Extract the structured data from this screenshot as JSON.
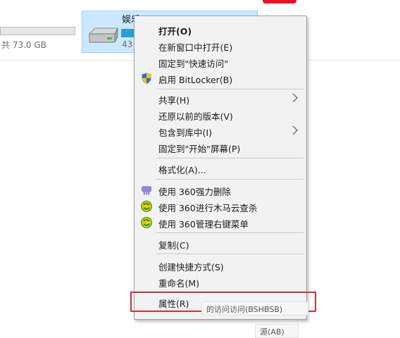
{
  "explorer": {
    "left_drive_caption": "共 73.0 GB",
    "selected_drive": {
      "name": "娱乐 (G:)",
      "size_text": "43",
      "usage_fraction": 0.1
    },
    "colors": {
      "selection": "#cce8ff",
      "usage_bar": "#26a0da",
      "accent": "#e81123"
    }
  },
  "context_menu": {
    "items": [
      {
        "id": "open",
        "label": "打开(O)",
        "bold": true
      },
      {
        "id": "open-new-window",
        "label": "在新窗口中打开(E)"
      },
      {
        "id": "pin-quick-access",
        "label": "固定到\"快速访问\""
      },
      {
        "id": "bitlocker",
        "label": "启用 BitLocker(B)",
        "icon": "shield-icon"
      },
      {
        "id": "share",
        "label": "共享(H)",
        "submenu": true
      },
      {
        "id": "restore-versions",
        "label": "还原以前的版本(V)"
      },
      {
        "id": "include-library",
        "label": "包含到库中(I)",
        "submenu": true
      },
      {
        "id": "pin-start",
        "label": "固定到\"开始\"屏幕(P)"
      },
      {
        "id": "format",
        "label": "格式化(A)..."
      },
      {
        "id": "360-delete",
        "label": "使用 360强力删除",
        "icon": "360-shred-icon"
      },
      {
        "id": "360-scan",
        "label": "使用 360进行木马云查杀",
        "icon": "360-guard-icon"
      },
      {
        "id": "360-menu",
        "label": "使用 360管理右键菜单",
        "icon": "360-guard-icon"
      },
      {
        "id": "copy",
        "label": "复制(C)"
      },
      {
        "id": "create-shortcut",
        "label": "创建快捷方式(S)"
      },
      {
        "id": "rename",
        "label": "重命名(M)"
      },
      {
        "id": "properties",
        "label": "属性(R)",
        "highlighted": true
      }
    ],
    "highlight_color": "#c8323c"
  },
  "tooltips": {
    "first": "的访问访问(BSHBSB)",
    "second": "源(AB)"
  }
}
